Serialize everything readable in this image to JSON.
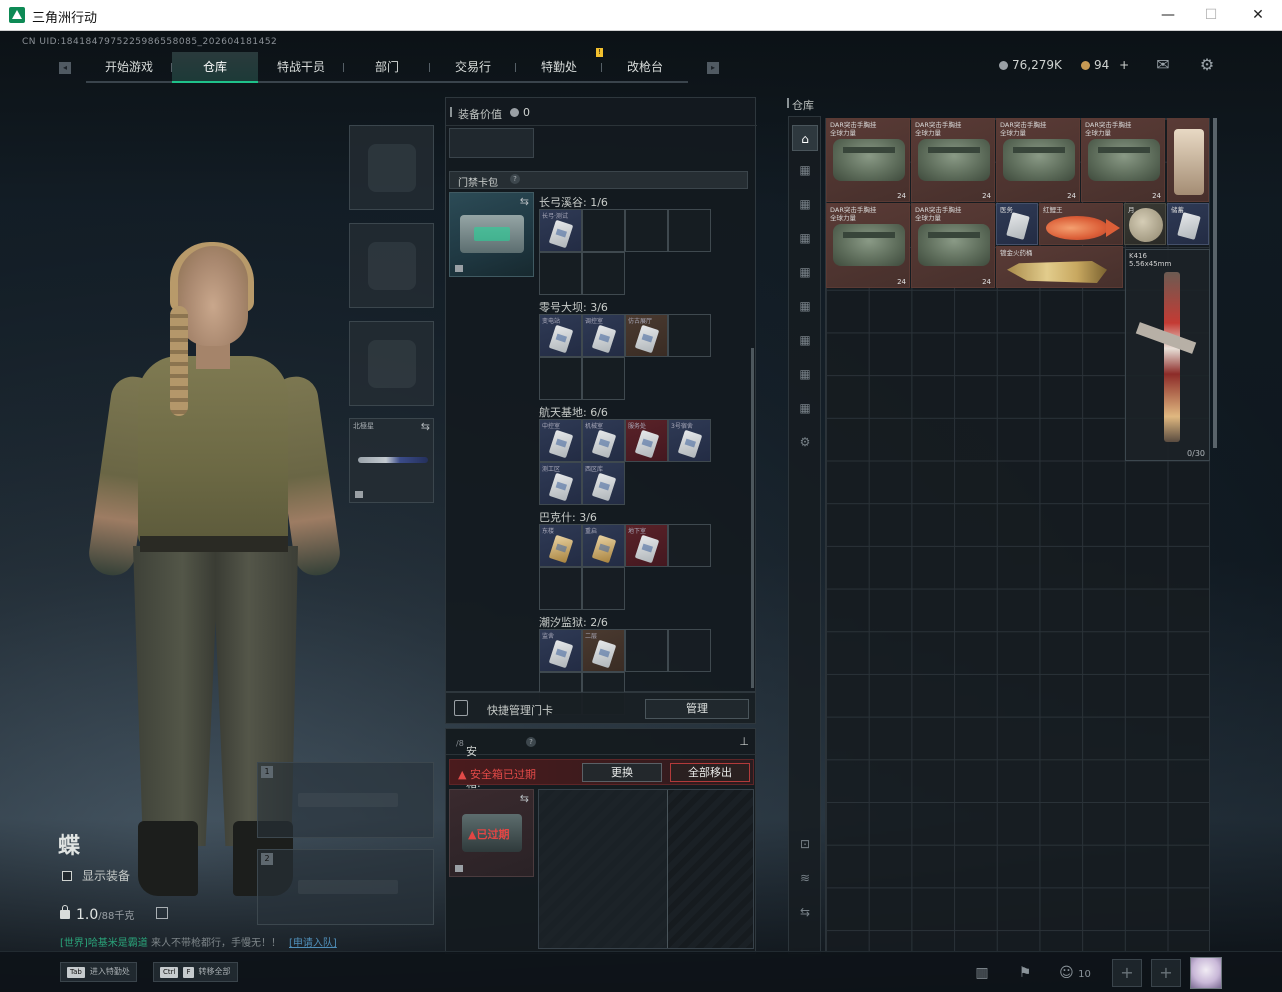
{
  "window": {
    "title": "三角洲行动",
    "minimize": "—",
    "maximize": "☐",
    "close": "✕"
  },
  "uid": "CN UID:1841847975225986558085_202604181452",
  "nav": {
    "tabs": [
      "开始游戏",
      "仓库",
      "特战干员",
      "部门",
      "交易行",
      "特勤处",
      "改枪台"
    ],
    "active": "仓库",
    "notif_badge": "!"
  },
  "currency": {
    "coins": "76,279K",
    "gold": "94",
    "add": "+"
  },
  "icons": {
    "mail": "mail-icon",
    "settings": "gear-icon"
  },
  "character": {
    "name": "蝶",
    "show_equipment": "显示装备",
    "weight_value": "1.0",
    "weight_max": "/88千克"
  },
  "chat": {
    "channel": "[世界]",
    "name": "哈基米是霸道",
    "message": "来人不带枪都行，手慢无！！",
    "action": "[申请入队]"
  },
  "slots": {
    "knife_label": "北極星",
    "gun1": "1",
    "gun2": "2"
  },
  "equipment": {
    "value_label": "装备价值",
    "value": "0",
    "keycard_section": "门禁卡包",
    "help": "?",
    "maps": [
      {
        "label": "长弓溪谷: 1/6",
        "cards": [
          {
            "name": "长弓·测试",
            "tone": "blue"
          }
        ]
      },
      {
        "label": "零号大坝: 3/6",
        "cards": [
          {
            "name": "变电站",
            "tone": "blue"
          },
          {
            "name": "调控室",
            "tone": "blue"
          },
          {
            "name": "仿古展厅",
            "tone": "brown"
          }
        ]
      },
      {
        "label": "航天基地: 6/6",
        "cards": [
          {
            "name": "中控室",
            "tone": "blue"
          },
          {
            "name": "机械室",
            "tone": "blue"
          },
          {
            "name": "服务处",
            "tone": "red"
          },
          {
            "name": "3号宿舍",
            "tone": "blue"
          },
          {
            "name": "测工区",
            "tone": "blue"
          },
          {
            "name": "西区库",
            "tone": "blue"
          }
        ]
      },
      {
        "label": "巴克什: 3/6",
        "cards": [
          {
            "name": "东楼",
            "tone": "gold"
          },
          {
            "name": "重启",
            "tone": "gold"
          },
          {
            "name": "地下室",
            "tone": "red"
          }
        ]
      },
      {
        "label": "潮汐监狱: 2/6",
        "cards": [
          {
            "name": "监舍",
            "tone": "blue"
          },
          {
            "name": "二层",
            "tone": "brown"
          }
        ]
      }
    ],
    "quick_manage": "快捷管理门卡",
    "manage_button": "管理"
  },
  "safe": {
    "title": "安全箱: 0",
    "capacity": "/8",
    "help": "?",
    "pin": "⊥",
    "expired_warning": "安全箱已过期",
    "replace_button": "更换",
    "move_all_button": "全部移出",
    "box_label": "已过期"
  },
  "warehouse": {
    "title": "仓库",
    "side_tabs": [
      "⌂",
      "▦",
      "▦",
      "▦",
      "▦",
      "▦",
      "▦",
      "▦",
      "▦",
      "⚙",
      "⊡",
      "≋",
      "⇆"
    ],
    "items": [
      {
        "name1": "DAR突击手胸挂",
        "name2": "全球力量",
        "count": "24"
      },
      {
        "name1": "DAR突击手胸挂",
        "name2": "全球力量",
        "count": "24"
      },
      {
        "name1": "DAR突击手胸挂",
        "name2": "全球力量",
        "count": "24"
      },
      {
        "name1": "DAR突击手胸挂",
        "name2": "全球力量",
        "count": "24"
      },
      {
        "name1": "DAR突击手胸挂",
        "name2": "全球力量",
        "count": "24"
      },
      {
        "name1": "DAR突击手胸挂",
        "name2": "全球力量",
        "count": "24"
      }
    ],
    "small_items": {
      "card": "医务",
      "fish": "红鲤王",
      "gold_gun": "镀金火药桶",
      "moon": "月",
      "card2": "储蓄"
    },
    "rifle": {
      "name": "K416",
      "caliber": "5.56x45mm",
      "ammo": "0/30"
    }
  },
  "bottom": {
    "hint1_key": "Tab",
    "hint1_text": "进入特勤处",
    "hint2_key": "Ctrl",
    "hint2_key2": "F",
    "hint2_text": "转移全部",
    "friends": "10",
    "plus": "+"
  }
}
